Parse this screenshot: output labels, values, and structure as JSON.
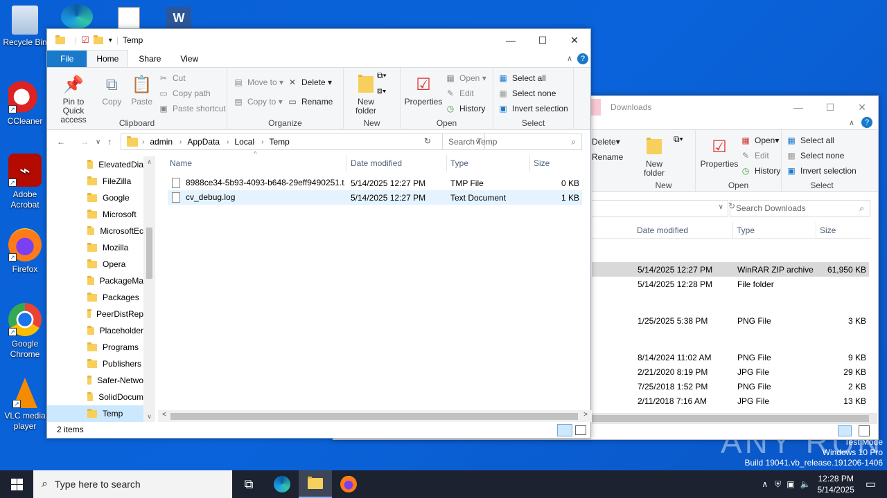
{
  "desktop": {
    "icons": [
      {
        "label": "Recycle Bin",
        "name": "recycle-bin-icon"
      },
      {
        "label": "CCleaner",
        "name": "ccleaner-icon"
      },
      {
        "label": "Adobe Acrobat",
        "name": "adobe-acrobat-icon"
      },
      {
        "label": "Firefox",
        "name": "firefox-icon"
      },
      {
        "label": "Google Chrome",
        "name": "chrome-icon"
      },
      {
        "label": "VLC media player",
        "name": "vlc-icon"
      }
    ],
    "watermark": {
      "brand": "ANY RUN",
      "test_mode": "Test Mode",
      "edition": "Windows 10 Pro",
      "build": "Build 19041.vb_release.191206-1406"
    }
  },
  "temp_window": {
    "title": "Temp",
    "tabs": [
      "File",
      "Home",
      "Share",
      "View"
    ],
    "clipboard": {
      "pin": "Pin to Quick access",
      "copy": "Copy",
      "paste": "Paste",
      "cut": "Cut",
      "copy_path": "Copy path",
      "paste_shortcut": "Paste shortcut",
      "label": "Clipboard"
    },
    "organize": {
      "move_to": "Move to",
      "copy_to": "Copy to",
      "delete": "Delete",
      "rename": "Rename",
      "label": "Organize"
    },
    "new": {
      "new_folder": "New folder",
      "label": "New"
    },
    "open": {
      "properties": "Properties",
      "open": "Open",
      "edit": "Edit",
      "history": "History",
      "label": "Open"
    },
    "select": {
      "select_all": "Select all",
      "select_none": "Select none",
      "invert": "Invert selection",
      "label": "Select"
    },
    "breadcrumb": [
      "admin",
      "AppData",
      "Local",
      "Temp"
    ],
    "search_placeholder": "Search Temp",
    "nav_items": [
      "ElevatedDia",
      "FileZilla",
      "Google",
      "Microsoft",
      "MicrosoftEc",
      "Mozilla",
      "Opera",
      "PackageMa",
      "Packages",
      "PeerDistRep",
      "Placeholder",
      "Programs",
      "Publishers",
      "Safer-Netwo",
      "SolidDocum",
      "Temp"
    ],
    "columns": [
      "Name",
      "Date modified",
      "Type",
      "Size"
    ],
    "files": [
      {
        "name": "8988ce34-5b93-4093-b648-29eff9490251.t...",
        "date": "5/14/2025 12:27 PM",
        "type": "TMP File",
        "size": "0 KB"
      },
      {
        "name": "cv_debug.log",
        "date": "5/14/2025 12:27 PM",
        "type": "Text Document",
        "size": "1 KB"
      }
    ],
    "status": "2 items"
  },
  "downloads_window": {
    "title": "Downloads",
    "delete": "Delete",
    "rename": "Rename",
    "new_folder": "New folder",
    "new_label": "New",
    "properties": "Properties",
    "open": "Open",
    "edit": "Edit",
    "history": "History",
    "open_label": "Open",
    "select_all": "Select all",
    "select_none": "Select none",
    "invert": "Invert selection",
    "select_label": "Select",
    "search_placeholder": "Search Downloads",
    "columns": [
      "Date modified",
      "Type",
      "Size"
    ],
    "rows": [
      {
        "date": "5/14/2025 12:27 PM",
        "type": "WinRAR ZIP archive",
        "size": "61,950 KB"
      },
      {
        "date": "5/14/2025 12:28 PM",
        "type": "File folder",
        "size": ""
      },
      {
        "date": "1/25/2025 5:38 PM",
        "type": "PNG File",
        "size": "3 KB"
      },
      {
        "date": "8/14/2024 11:02 AM",
        "type": "PNG File",
        "size": "9 KB"
      },
      {
        "date": "2/21/2020 8:19 PM",
        "type": "JPG File",
        "size": "29 KB"
      },
      {
        "date": "7/25/2018 1:52 PM",
        "type": "PNG File",
        "size": "2 KB"
      },
      {
        "date": "2/11/2018 7:16 AM",
        "type": "JPG File",
        "size": "13 KB"
      }
    ]
  },
  "taskbar": {
    "search_placeholder": "Type here to search",
    "time": "12:28 PM",
    "date": "5/14/2025"
  }
}
